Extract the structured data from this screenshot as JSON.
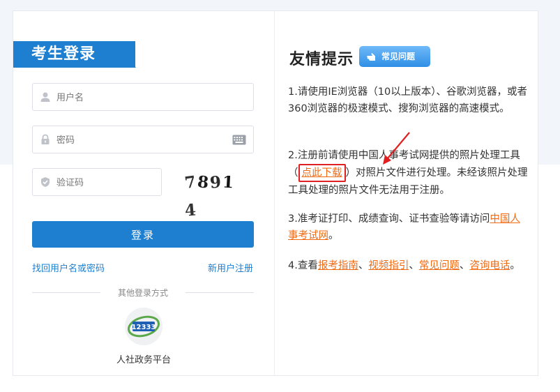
{
  "login": {
    "title": "考生登录",
    "username_placeholder": "用户名",
    "password_placeholder": "密码",
    "captcha_placeholder": "验证码",
    "captcha_chars": [
      "7",
      "8",
      "9",
      "1",
      "4"
    ],
    "submit_label": "登录",
    "forgot_link": "找回用户名或密码",
    "register_link": "新用户注册",
    "other_methods_label": "其他登录方式",
    "gov_platform_label": "人社政务平台",
    "gov_logo_text": "12333"
  },
  "tips": {
    "title": "友情提示",
    "faq_badge": "常见问题",
    "tip1": "1.请使用IE浏览器（10以上版本）、谷歌浏览器，或者360浏览器的极速模式、搜狗浏览器的高速模式。",
    "tip2_prefix": "2.注册前请使用中国人事考试网提供的照片处理工具（",
    "tip2_link": "点此下载",
    "tip2_suffix": "）对照片文件进行处理。未经该照片处理工具处理的照片文件无法用于注册。",
    "tip3_prefix": "3.准考证打印、成绩查询、证书查验等请访问",
    "tip3_link": "中国人事考试网",
    "tip3_suffix": "。",
    "tip4_prefix": "4.查看",
    "tip4_links": [
      "报考指南",
      "视频指引",
      "常见问题",
      "咨询电话"
    ],
    "tip4_sep": "、",
    "tip4_suffix": "。"
  },
  "colors": {
    "brand_blue": "#1e7fd0",
    "link_orange": "#f06a14",
    "highlight_red": "#e02020"
  }
}
